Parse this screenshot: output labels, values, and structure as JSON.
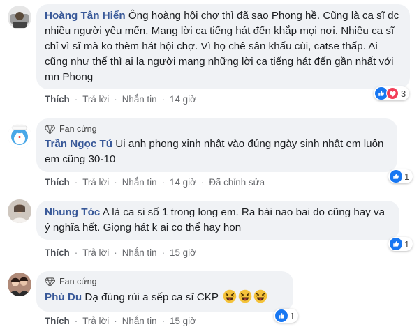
{
  "comments": [
    {
      "author": "Hoàng Tân Hiển",
      "text": "Ông hoàng hội chợ thì đã sao Phong hề. Cũng là ca sĩ dc nhiều người yêu mến. Mang lời ca tiếng hát đến khắp mọi nơi. Nhiều ca sĩ chỉ vì sĩ mà ko thèm hát hội chợ. Vì họ chê sân khấu cùi, catse thấp. Ai cũng như thế thì ai la người mang những lời ca tiếng hát đến gần nhất với mn Phong",
      "actions": {
        "like": "Thích",
        "reply": "Trả lời",
        "message": "Nhắn tin",
        "time": "14 giờ"
      },
      "reaction_count": "3"
    },
    {
      "badge": "Fan cứng",
      "author": "Trần Ngọc Tú",
      "text": "Ui anh phong xinh nhật vào đúng ngày sinh nhật em luôn em cũng 30-10",
      "actions": {
        "like": "Thích",
        "reply": "Trả lời",
        "message": "Nhắn tin",
        "time": "14 giờ",
        "edited": "Đã chỉnh sửa"
      },
      "reaction_count": "1"
    },
    {
      "author": "Nhung Tóc",
      "text": "A là ca si số 1 trong long em. Ra bài nao bai do cũng hay va ý nghĩa hết. Giọng hát k ai co thể hay hon",
      "actions": {
        "like": "Thích",
        "reply": "Trả lời",
        "message": "Nhắn tin",
        "time": "15 giờ"
      },
      "reaction_count": "1"
    },
    {
      "badge": "Fan cứng",
      "author": "Phù Du",
      "text": "Dạ đúng rùi a sếp ca sĩ CKP",
      "actions": {
        "like": "Thích",
        "reply": "Trả lời",
        "message": "Nhắn tin",
        "time": "15 giờ"
      },
      "reaction_count": "1"
    }
  ],
  "colors": {
    "author": "#385898",
    "bubble": "#f0f2f5",
    "like_blue": "#1877f2",
    "love_red": "#f33e58"
  }
}
